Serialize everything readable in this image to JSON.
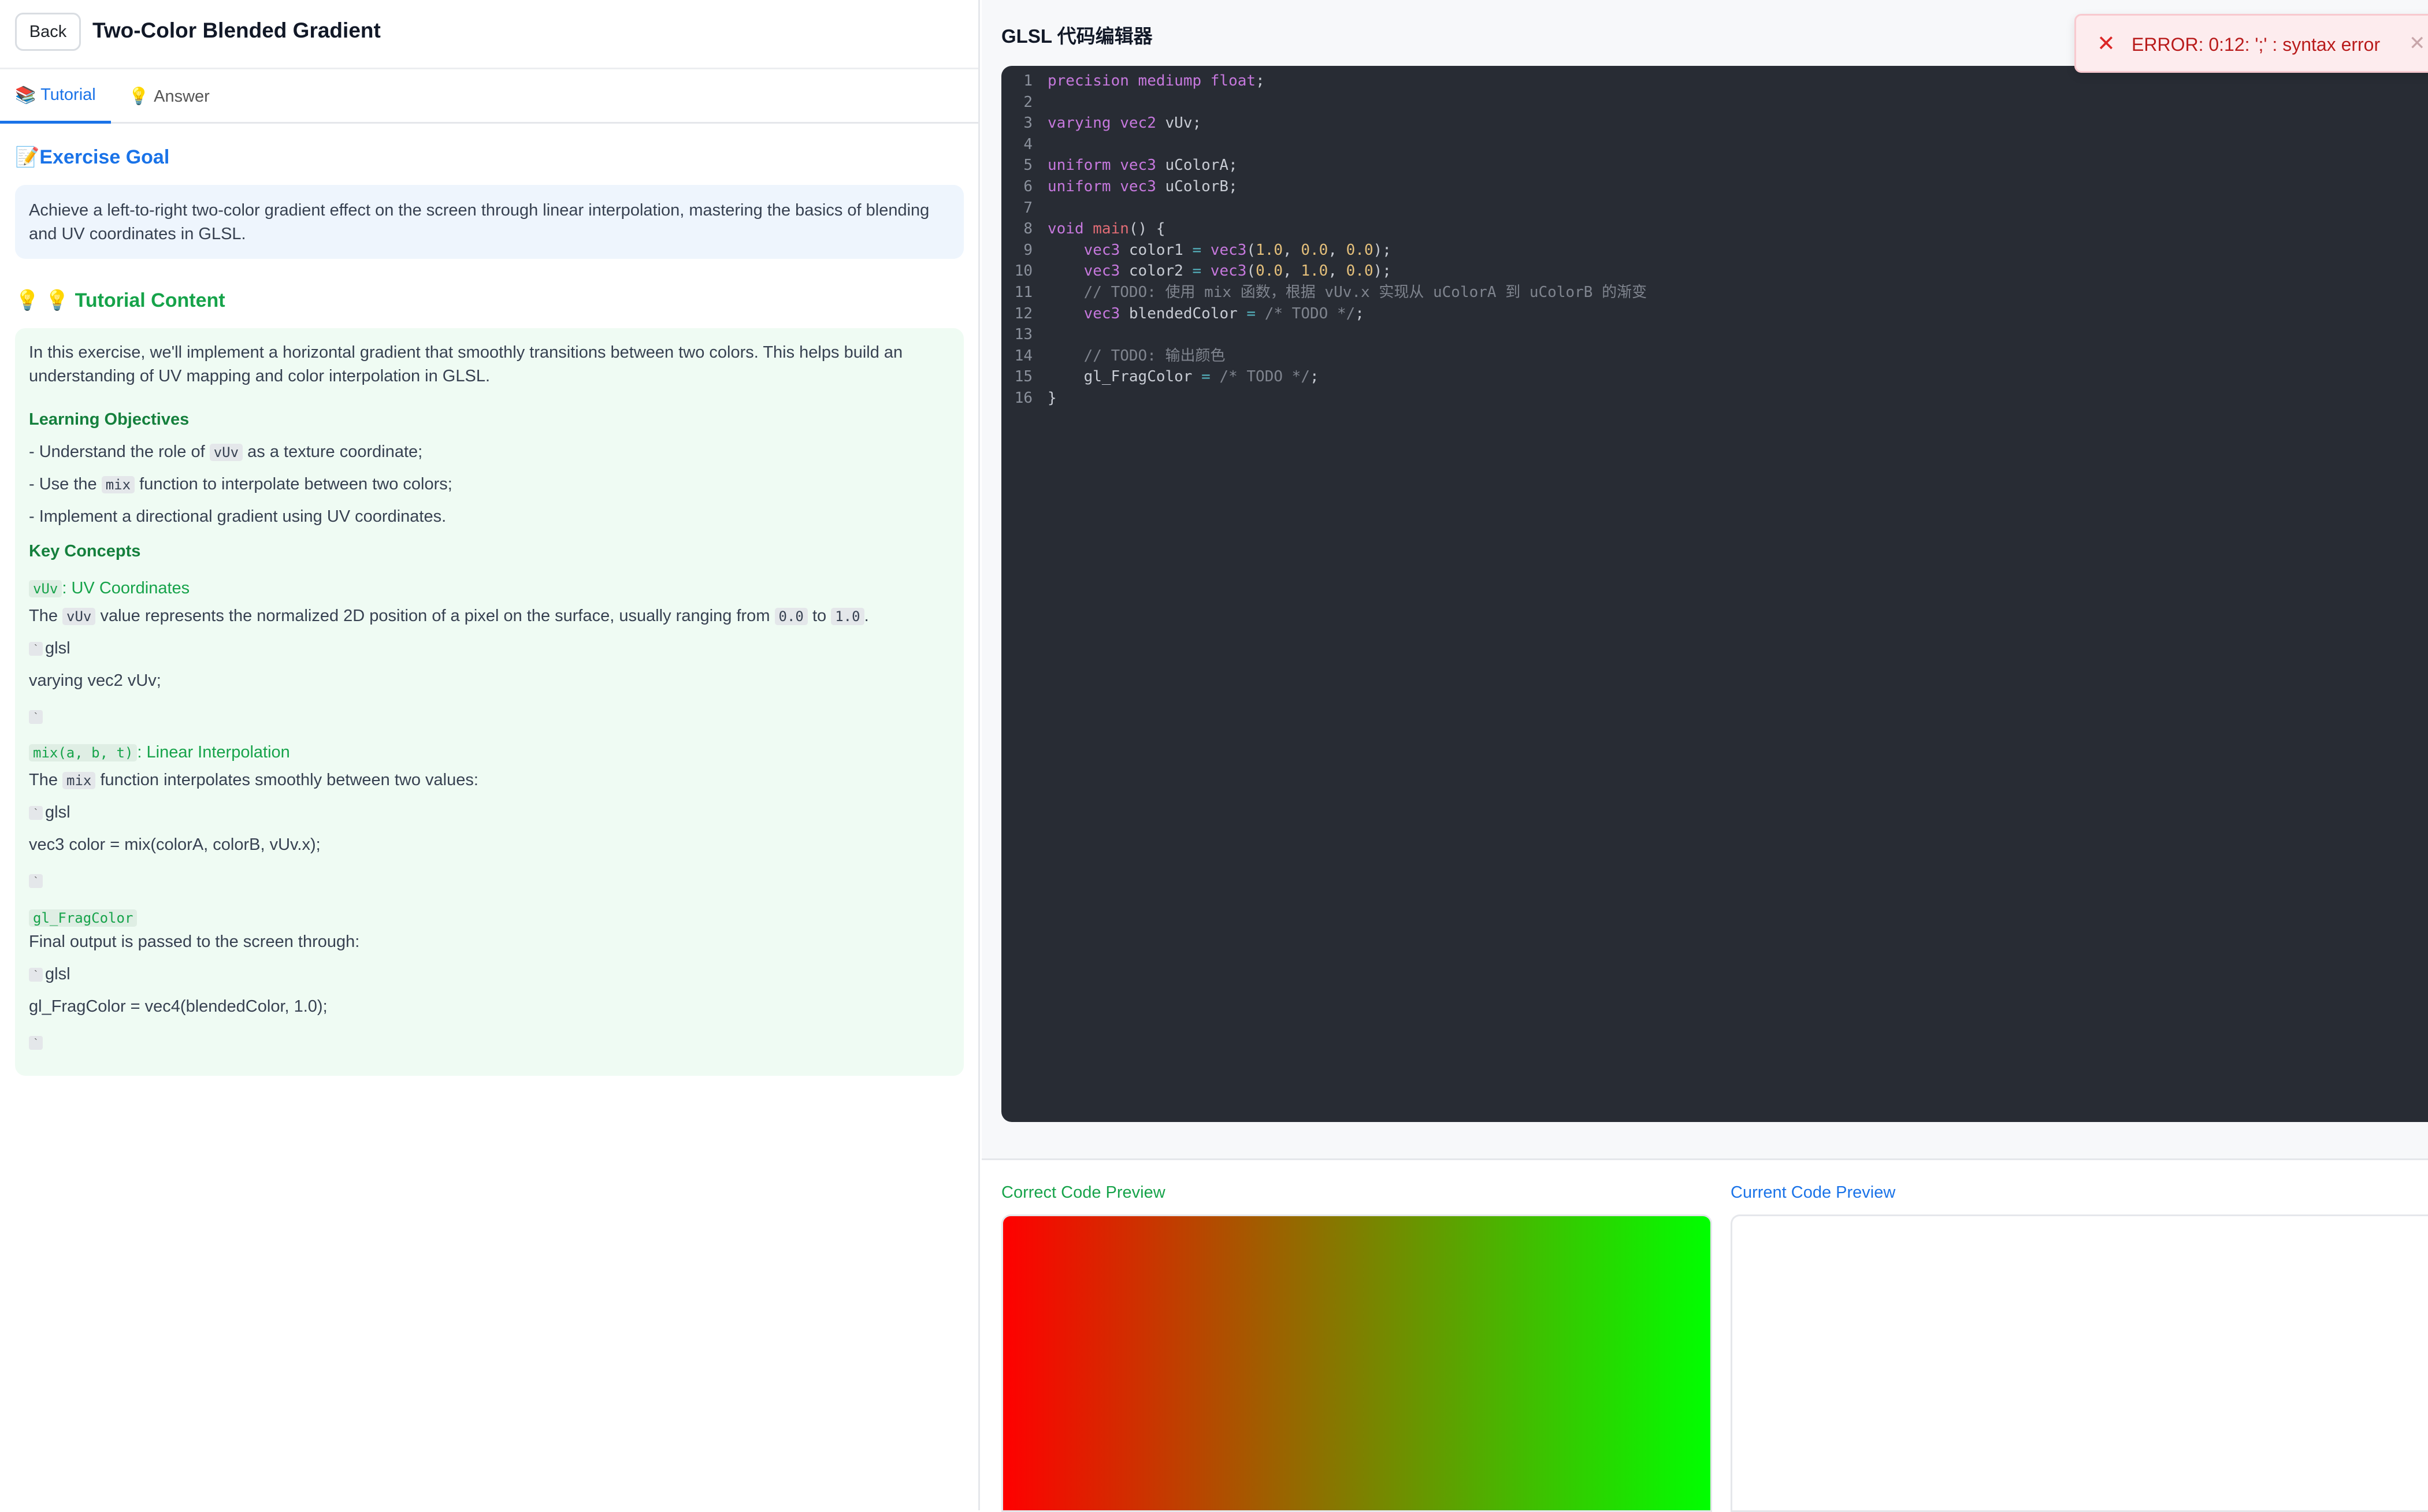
{
  "header": {
    "back_label": "Back",
    "title": "Two-Color Blended Gradient"
  },
  "tabs": [
    {
      "icon": "📚",
      "icon_name": "books-icon",
      "label": "Tutorial"
    },
    {
      "icon": "💡",
      "icon_name": "lightbulb-icon",
      "label": "Answer"
    }
  ],
  "goal": {
    "icon": "📝",
    "title": "Exercise Goal",
    "text": "Achieve a left-to-right two-color gradient effect on the screen through linear interpolation, mastering the basics of blending and UV coordinates in GLSL."
  },
  "tutorial": {
    "icons": "💡 💡",
    "title": "Tutorial Content",
    "intro": "In this exercise, we'll implement a horizontal gradient that smoothly transitions between two colors. This helps build an understanding of UV mapping and color interpolation in GLSL.",
    "objectives_heading": "Learning Objectives",
    "obj1_pre": "- Understand the role of ",
    "obj1_code": "vUv",
    "obj1_post": " as a texture coordinate;",
    "obj2_pre": "- Use the ",
    "obj2_code": "mix",
    "obj2_post": " function to interpolate between two colors;",
    "obj3": "- Implement a directional gradient using UV coordinates.",
    "concepts_heading": "Key Concepts",
    "c1_code": "vUv",
    "c1_title": ": UV Coordinates",
    "c1_pre": "The ",
    "c1_code2": "vUv",
    "c1_mid": " value represents the normalized 2D position of a pixel on the surface, usually ranging from ",
    "c1_v1": "0.0",
    "c1_to": " to ",
    "c1_v2": "1.0",
    "c1_end": ".",
    "c1_lang": "glsl",
    "c1_codeline": "varying vec2 vUv;",
    "c2_code": "mix(a, b, t)",
    "c2_title": ": Linear Interpolation",
    "c2_pre": "The ",
    "c2_code2": "mix",
    "c2_post": " function interpolates smoothly between two values:",
    "c2_lang": "glsl",
    "c2_codeline": "vec3 color = mix(colorA, colorB, vUv.x);",
    "c3_code": "gl_FragColor",
    "c3_text": "Final output is passed to the screen through:",
    "c3_lang": "glsl",
    "c3_codeline": "gl_FragColor = vec4(blendedColor, 1.0);",
    "tick": "`"
  },
  "editor": {
    "title": "GLSL 代码编辑器",
    "lines": [
      {
        "n": "1",
        "t": "precision mediump float;"
      },
      {
        "n": "2",
        "t": ""
      },
      {
        "n": "3",
        "t": "varying vec2 vUv;"
      },
      {
        "n": "4",
        "t": ""
      },
      {
        "n": "5",
        "t": "uniform vec3 uColorA;"
      },
      {
        "n": "6",
        "t": "uniform vec3 uColorB;"
      },
      {
        "n": "7",
        "t": ""
      },
      {
        "n": "8",
        "t": "void main() {"
      },
      {
        "n": "9",
        "t": "    vec3 color1 = vec3(1.0, 0.0, 0.0);"
      },
      {
        "n": "10",
        "t": "    vec3 color2 = vec3(0.0, 1.0, 0.0);"
      },
      {
        "n": "11",
        "t": "    // TODO: 使用 mix 函数，根据 vUv.x 实现从 uColorA 到 uColorB 的渐变"
      },
      {
        "n": "12",
        "t": "    vec3 blendedColor = /* TODO */;"
      },
      {
        "n": "13",
        "t": ""
      },
      {
        "n": "14",
        "t": "    // TODO: 输出颜色"
      },
      {
        "n": "15",
        "t": "    gl_FragColor = /* TODO */;"
      },
      {
        "n": "16",
        "t": "}"
      }
    ]
  },
  "error_toast": {
    "icon": "✕",
    "text": "ERROR: 0:12: ';' : syntax error",
    "close": "✕"
  },
  "preview": {
    "correct_label": "Correct Code Preview",
    "current_label": "Current Code Preview",
    "gradient_start": "#ff0000",
    "gradient_end": "#00ff00"
  },
  "colors": {
    "accent_blue": "#1a73e8",
    "accent_green": "#16a34a",
    "editor_bg": "#282c34",
    "error_red": "#dc2626"
  }
}
